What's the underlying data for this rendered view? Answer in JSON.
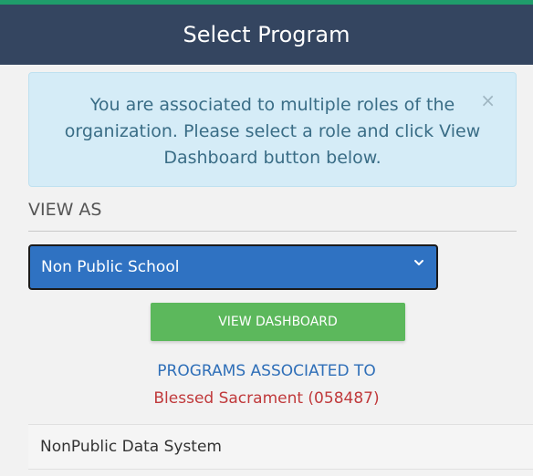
{
  "colors": {
    "accent": "#1f9c6b",
    "header_bg": "#344560",
    "alert_bg": "#d5ecf7",
    "select_bg": "#2f72c2",
    "button_bg": "#5cb85c",
    "link_blue": "#2f6fb8",
    "org_red": "#c0393b"
  },
  "header": {
    "title": "Select Program"
  },
  "alert": {
    "message": "You are associated to multiple roles of the organization. Please select a role and click View Dashboard button below.",
    "close_icon": "×"
  },
  "view_as": {
    "label": "VIEW AS",
    "selected": "Non Public School",
    "chevron_icon": "⌄"
  },
  "actions": {
    "view_dashboard_label": "VIEW DASHBOARD"
  },
  "programs": {
    "heading": "PROGRAMS ASSOCIATED TO",
    "organization": "Blessed Sacrament (058487)",
    "items": [
      {
        "label": "NonPublic Data System"
      }
    ]
  }
}
